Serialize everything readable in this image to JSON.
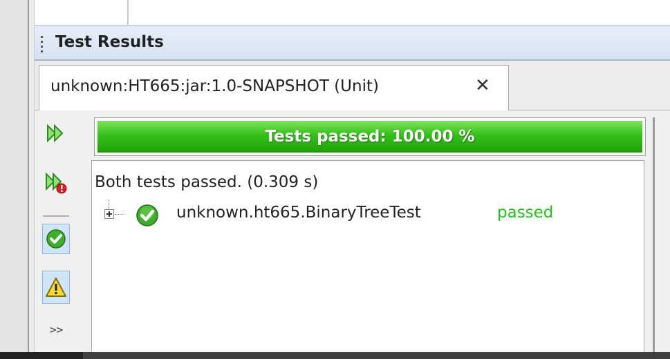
{
  "panel": {
    "title": "Test Results"
  },
  "tab": {
    "label": "unknown:HT665:jar:1.0-SNAPSHOT (Unit)",
    "close_glyph": "✕"
  },
  "toolbar": {
    "rerun_icon": "rerun-all-icon",
    "rerun_failed_icon": "rerun-failed-icon",
    "show_passed_icon": "show-passed-icon",
    "show_warnings_icon": "warning-filter-icon",
    "more_label": ">>"
  },
  "progress": {
    "label": "Tests passed: 100.00 %",
    "fraction": 1.0,
    "color": "#34bf1b"
  },
  "results": {
    "summary": "Both tests passed. (0.309 s)",
    "items": [
      {
        "name": "unknown.ht665.BinaryTreeTest",
        "status": "passed",
        "status_color": "#23c21b"
      }
    ]
  }
}
